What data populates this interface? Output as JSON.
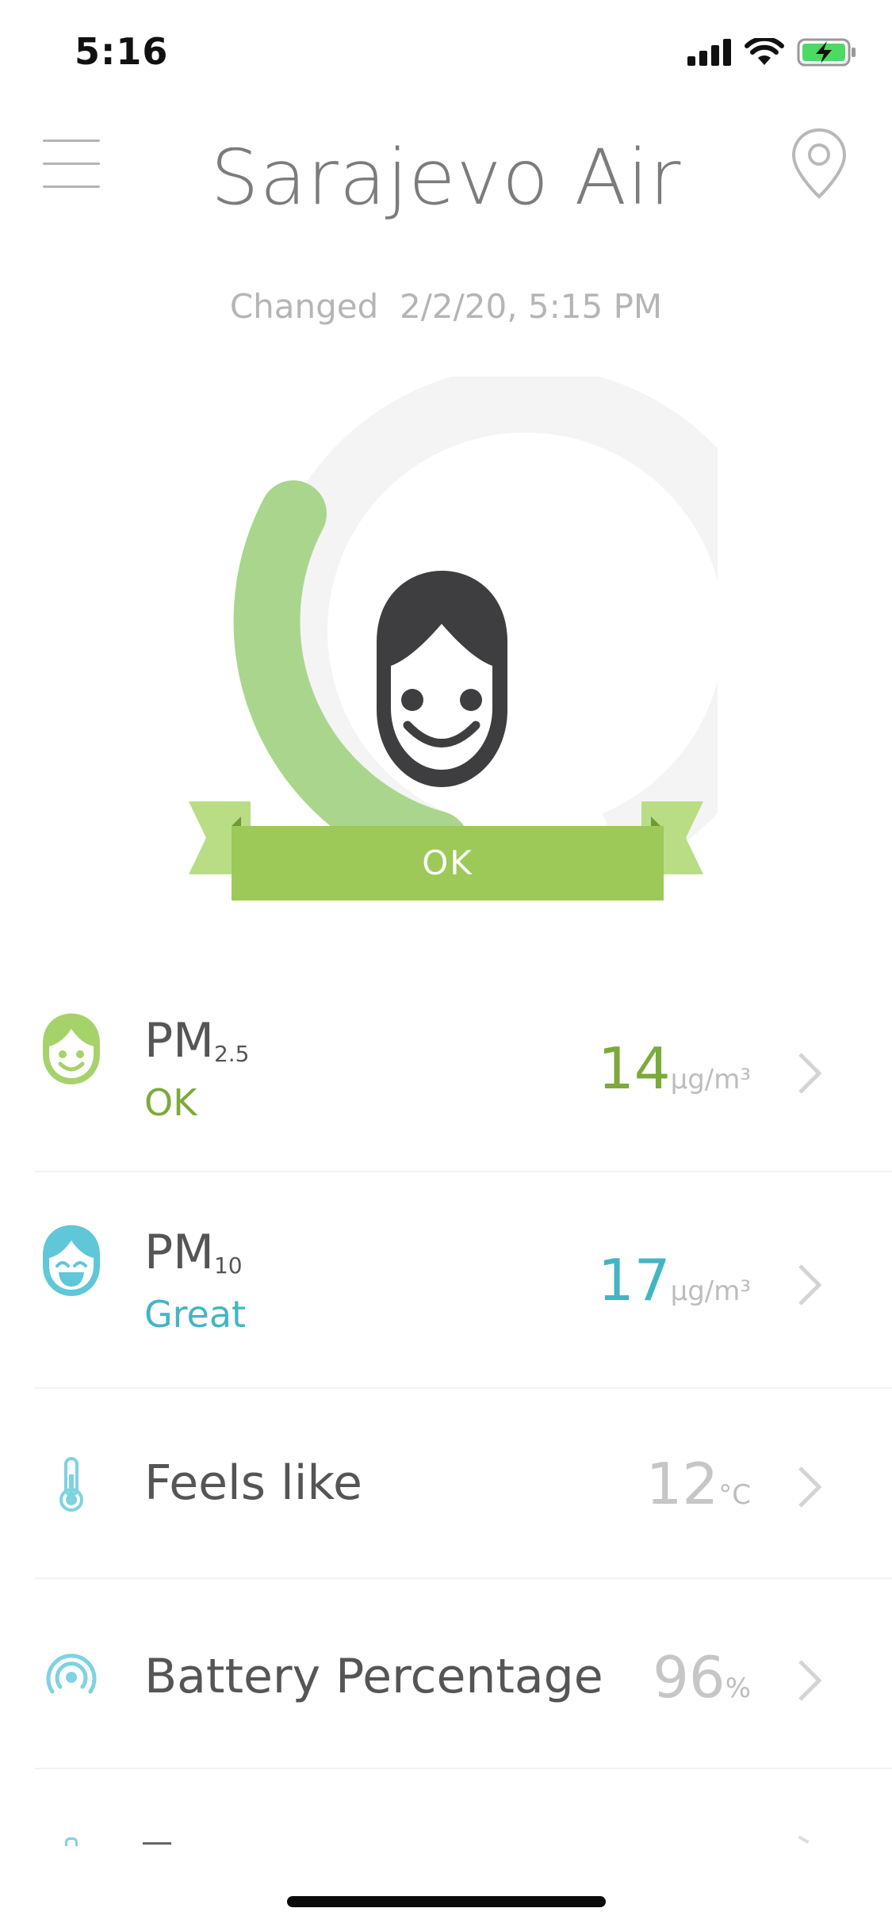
{
  "status_bar": {
    "time": "5:16"
  },
  "header": {
    "title": "Sarajevo Air",
    "changed_label": "Changed",
    "changed_value": "2/2/20, 5:15 PM"
  },
  "gauge": {
    "label": "OK",
    "level": 0.18,
    "accent": "#9cc957",
    "track": "#f4f4f4",
    "arc": "#a9d68c"
  },
  "rows": [
    {
      "label": "PM",
      "sub": "2.5",
      "status": "OK",
      "status_color": "#7caa3b",
      "value": "14",
      "value_color": "#7caa3b",
      "unit": "µg/m³",
      "icon": "smile-face-icon"
    },
    {
      "label": "PM",
      "sub": "10",
      "status": "Great",
      "status_color": "#43b5c3",
      "value": "17",
      "value_color": "#43b5c3",
      "unit": "µg/m³",
      "icon": "laugh-face-icon"
    },
    {
      "label": "Feels like",
      "value": "12",
      "unit": "°C",
      "icon": "thermometer-icon"
    },
    {
      "label": "Battery Percentage",
      "value": "96",
      "unit": "%",
      "icon": "signal-icon"
    }
  ]
}
